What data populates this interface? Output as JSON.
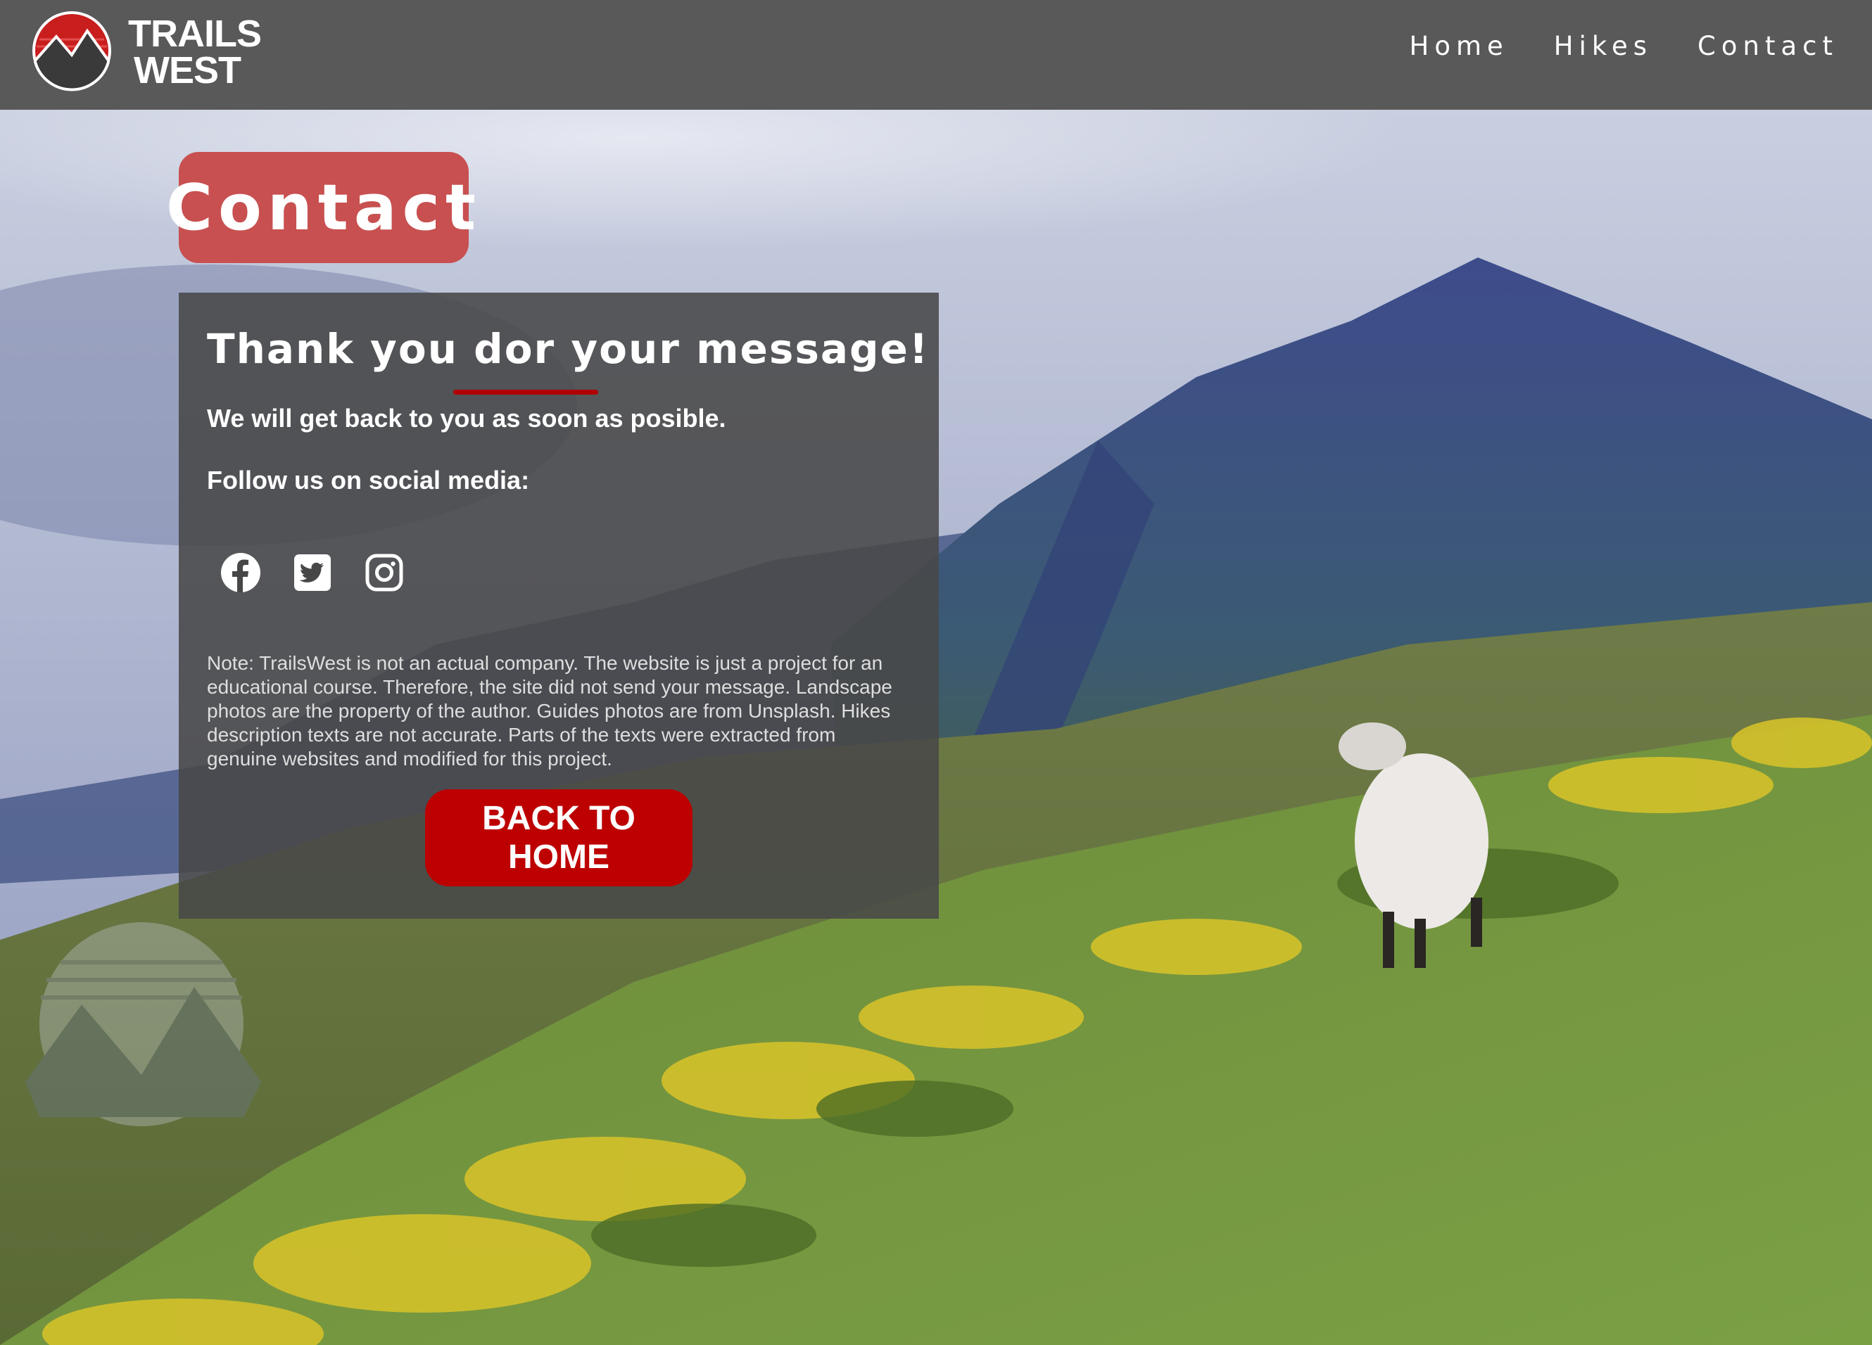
{
  "header": {
    "logo": {
      "line1": "TRAILS",
      "line2": "WEST",
      "icon": "mountain-sunset-logo"
    },
    "nav": [
      {
        "label": "Home"
      },
      {
        "label": "Hikes"
      },
      {
        "label": "Contact"
      }
    ]
  },
  "page": {
    "title": "Contact"
  },
  "card": {
    "heading": "Thank you dor your message!",
    "subtext": "We will get back to you as soon as posible.",
    "follow": "Follow us on social media:",
    "socials": [
      {
        "icon": "facebook-icon"
      },
      {
        "icon": "twitter-icon"
      },
      {
        "icon": "instagram-icon"
      }
    ],
    "note": "Note: TrailsWest is not an actual company. The website is just a project for an educational course. Therefore, the site did not send your message. Landscape photos are the property of the author. Guides photos are from Unsplash. Hikes description texts are not accurate. Parts of the texts were extracted from genuine websites and modified for this project.",
    "button_label": "BACK TO HOME"
  },
  "colors": {
    "header_bg": "#595959",
    "title_pill": "#c85050",
    "accent_red": "#bd0000",
    "card_bg": "#484848"
  }
}
